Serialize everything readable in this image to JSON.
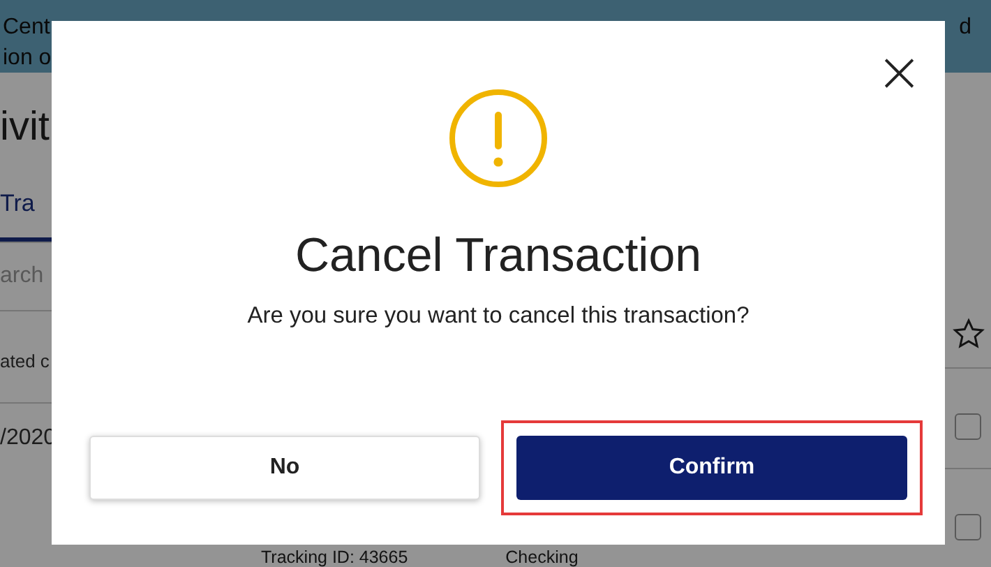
{
  "background": {
    "banner_left": [
      "Cent",
      "ion o"
    ],
    "banner_right": [
      "d"
    ],
    "heading": "ivit",
    "tab": {
      "label": "Tra",
      "selected": true
    },
    "search": {
      "placeholder": "arch"
    },
    "column_header": "ated c",
    "row": {
      "date": "/2020",
      "tracking": "Tracking ID: 43665",
      "status": "Checking",
      "checked": false
    },
    "header_checked": false
  },
  "dialog": {
    "title": "Cancel Transaction",
    "message": "Are you sure you want to cancel this transaction?",
    "close": "×",
    "buttons": [
      {
        "label": "No",
        "kind": "secondary"
      },
      {
        "label": "Confirm",
        "kind": "primary",
        "highlighted": true
      }
    ]
  }
}
